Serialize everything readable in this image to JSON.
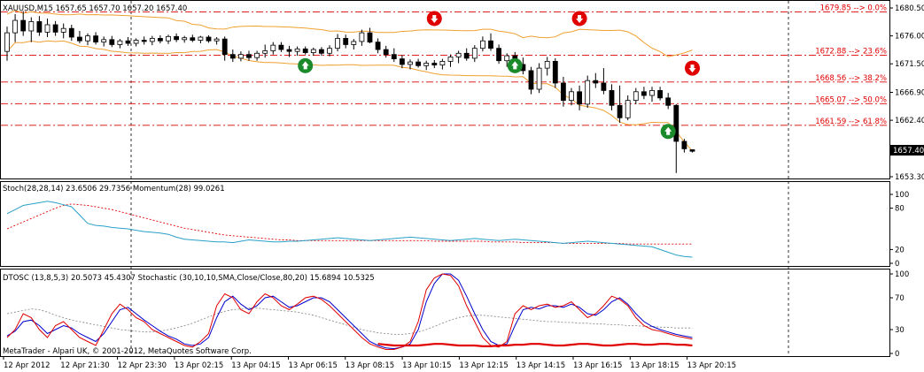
{
  "main_panel": {
    "symbol_header": "XAUUSD,M15  1657.65 1657.70 1657.20 1657.40",
    "price_ticks": [
      "1680.50",
      "1676.00",
      "1671.50",
      "1666.90",
      "1662.40",
      "1653.30"
    ],
    "current_price": "1657.40",
    "fib_levels": [
      {
        "label": "1679.85 --> 0.0%",
        "price": 1679.85
      },
      {
        "label": "1672.88 --> 23.6%",
        "price": 1672.88
      },
      {
        "label": "1668.56 --> 38.2%",
        "price": 1668.56
      },
      {
        "label": "1665.07 --> 50.0%",
        "price": 1665.07
      },
      {
        "label": "1661.59 --> 61.8%",
        "price": 1661.59
      }
    ],
    "colors": {
      "fib": "#e00000",
      "bands": "#f0a030",
      "bull_body": "#ffffff",
      "bear_body": "#000000",
      "sell_signal": "#e00000",
      "buy_signal": "#1a8a2a"
    }
  },
  "stoch_panel": {
    "header": "Stoch(28,28,14) 23.6506 29.7356  Momentum(28) 99.0261",
    "ticks": [
      "100",
      "80",
      "20",
      "0"
    ],
    "colors": {
      "main": "#2aa0c8",
      "signal": "#e00000"
    }
  },
  "dtosc_panel": {
    "header": "DTOSC (13,8,5,3) 20.5073 45.4307  Stochastic (30,10,10,SMA,Close/Close,80,20) 15.6894 10.5325",
    "ticks": [
      "100",
      "70",
      "30",
      "0"
    ],
    "colors": {
      "fast": "#e00000",
      "slow": "#0000cc",
      "gray": "#808080"
    }
  },
  "footer_text": "MetaTrader - Alpari UK, © 2001-2012, MetaQuotes Software Corp.",
  "time_labels": [
    "12 Apr 2012",
    "12 Apr 21:30",
    "12 Apr 23:30",
    "13 Apr 02:15",
    "13 Apr 04:15",
    "13 Apr 06:15",
    "13 Apr 08:15",
    "13 Apr 10:15",
    "13 Apr 12:15",
    "13 Apr 14:15",
    "13 Apr 16:15",
    "13 Apr 18:15",
    "13 Apr 20:15"
  ],
  "chart_data": {
    "type": "candlestick",
    "symbol": "XAUUSD",
    "timeframe": "M15",
    "ylim": [
      1653.3,
      1681.5
    ],
    "candles": [
      {
        "o": 1673.5,
        "h": 1677.5,
        "l": 1672.0,
        "c": 1676.5
      },
      {
        "o": 1676.5,
        "h": 1679.5,
        "l": 1675.0,
        "c": 1678.5
      },
      {
        "o": 1678.5,
        "h": 1680.0,
        "l": 1676.0,
        "c": 1676.8
      },
      {
        "o": 1676.8,
        "h": 1679.0,
        "l": 1675.0,
        "c": 1678.3
      },
      {
        "o": 1678.3,
        "h": 1679.2,
        "l": 1676.0,
        "c": 1676.6
      },
      {
        "o": 1676.6,
        "h": 1678.8,
        "l": 1675.8,
        "c": 1677.8
      },
      {
        "o": 1677.8,
        "h": 1678.4,
        "l": 1676.0,
        "c": 1676.6
      },
      {
        "o": 1676.6,
        "h": 1678.0,
        "l": 1675.6,
        "c": 1677.2
      },
      {
        "o": 1677.2,
        "h": 1677.8,
        "l": 1675.2,
        "c": 1675.8
      },
      {
        "o": 1675.8,
        "h": 1676.8,
        "l": 1674.8,
        "c": 1675.2
      },
      {
        "o": 1675.2,
        "h": 1676.4,
        "l": 1674.5,
        "c": 1676.0
      },
      {
        "o": 1676.0,
        "h": 1676.6,
        "l": 1674.6,
        "c": 1675.0
      },
      {
        "o": 1675.0,
        "h": 1675.9,
        "l": 1674.3,
        "c": 1675.4
      },
      {
        "o": 1675.4,
        "h": 1676.0,
        "l": 1674.2,
        "c": 1674.6
      },
      {
        "o": 1674.6,
        "h": 1675.5,
        "l": 1674.0,
        "c": 1675.2
      },
      {
        "o": 1675.2,
        "h": 1675.8,
        "l": 1674.4,
        "c": 1674.8
      },
      {
        "o": 1674.8,
        "h": 1675.6,
        "l": 1674.3,
        "c": 1675.3
      },
      {
        "o": 1675.3,
        "h": 1675.9,
        "l": 1674.6,
        "c": 1675.1
      },
      {
        "o": 1675.1,
        "h": 1676.0,
        "l": 1674.5,
        "c": 1675.6
      },
      {
        "o": 1675.6,
        "h": 1676.1,
        "l": 1674.8,
        "c": 1675.2
      },
      {
        "o": 1675.2,
        "h": 1676.2,
        "l": 1674.7,
        "c": 1675.9
      },
      {
        "o": 1675.9,
        "h": 1676.4,
        "l": 1675.0,
        "c": 1675.4
      },
      {
        "o": 1675.4,
        "h": 1676.0,
        "l": 1674.9,
        "c": 1675.7
      },
      {
        "o": 1675.7,
        "h": 1676.2,
        "l": 1675.0,
        "c": 1675.3
      },
      {
        "o": 1675.3,
        "h": 1676.0,
        "l": 1674.8,
        "c": 1675.8
      },
      {
        "o": 1675.8,
        "h": 1676.1,
        "l": 1674.9,
        "c": 1675.2
      },
      {
        "o": 1675.2,
        "h": 1675.8,
        "l": 1674.6,
        "c": 1675.5
      },
      {
        "o": 1675.5,
        "h": 1675.9,
        "l": 1672.0,
        "c": 1673.0
      },
      {
        "o": 1673.0,
        "h": 1673.8,
        "l": 1671.8,
        "c": 1672.4
      },
      {
        "o": 1672.4,
        "h": 1673.5,
        "l": 1671.9,
        "c": 1673.0
      },
      {
        "o": 1673.0,
        "h": 1673.6,
        "l": 1672.0,
        "c": 1672.5
      },
      {
        "o": 1672.5,
        "h": 1673.6,
        "l": 1672.0,
        "c": 1673.2
      },
      {
        "o": 1673.2,
        "h": 1674.6,
        "l": 1672.5,
        "c": 1673.6
      },
      {
        "o": 1673.6,
        "h": 1675.0,
        "l": 1673.0,
        "c": 1674.5
      },
      {
        "o": 1674.5,
        "h": 1675.0,
        "l": 1673.4,
        "c": 1673.8
      },
      {
        "o": 1673.8,
        "h": 1674.4,
        "l": 1672.6,
        "c": 1673.5
      },
      {
        "o": 1673.5,
        "h": 1674.3,
        "l": 1672.8,
        "c": 1673.9
      },
      {
        "o": 1673.9,
        "h": 1674.3,
        "l": 1673.0,
        "c": 1673.3
      },
      {
        "o": 1673.3,
        "h": 1674.1,
        "l": 1672.8,
        "c": 1673.8
      },
      {
        "o": 1673.8,
        "h": 1674.2,
        "l": 1672.8,
        "c": 1673.2
      },
      {
        "o": 1673.2,
        "h": 1674.5,
        "l": 1672.7,
        "c": 1674.0
      },
      {
        "o": 1674.0,
        "h": 1676.3,
        "l": 1673.5,
        "c": 1675.6
      },
      {
        "o": 1675.6,
        "h": 1676.2,
        "l": 1674.0,
        "c": 1674.6
      },
      {
        "o": 1674.6,
        "h": 1675.5,
        "l": 1673.8,
        "c": 1675.1
      },
      {
        "o": 1675.1,
        "h": 1677.0,
        "l": 1674.4,
        "c": 1676.5
      },
      {
        "o": 1676.5,
        "h": 1677.3,
        "l": 1674.8,
        "c": 1675.0
      },
      {
        "o": 1675.0,
        "h": 1675.6,
        "l": 1673.2,
        "c": 1673.8
      },
      {
        "o": 1673.8,
        "h": 1674.4,
        "l": 1672.5,
        "c": 1673.0
      },
      {
        "o": 1673.0,
        "h": 1674.0,
        "l": 1671.8,
        "c": 1672.3
      },
      {
        "o": 1672.3,
        "h": 1672.9,
        "l": 1670.8,
        "c": 1671.4
      },
      {
        "o": 1671.4,
        "h": 1672.2,
        "l": 1670.6,
        "c": 1671.8
      },
      {
        "o": 1671.8,
        "h": 1672.3,
        "l": 1670.9,
        "c": 1671.2
      },
      {
        "o": 1671.2,
        "h": 1672.0,
        "l": 1670.5,
        "c": 1671.6
      },
      {
        "o": 1671.6,
        "h": 1672.1,
        "l": 1670.8,
        "c": 1671.3
      },
      {
        "o": 1671.3,
        "h": 1672.3,
        "l": 1670.6,
        "c": 1671.9
      },
      {
        "o": 1671.9,
        "h": 1673.0,
        "l": 1671.0,
        "c": 1672.6
      },
      {
        "o": 1672.6,
        "h": 1673.6,
        "l": 1671.6,
        "c": 1673.2
      },
      {
        "o": 1673.2,
        "h": 1674.0,
        "l": 1672.0,
        "c": 1672.4
      },
      {
        "o": 1672.4,
        "h": 1674.5,
        "l": 1671.8,
        "c": 1674.0
      },
      {
        "o": 1674.0,
        "h": 1675.9,
        "l": 1673.5,
        "c": 1675.2
      },
      {
        "o": 1675.2,
        "h": 1676.4,
        "l": 1673.6,
        "c": 1674.0
      },
      {
        "o": 1674.0,
        "h": 1674.6,
        "l": 1671.5,
        "c": 1672.0
      },
      {
        "o": 1672.0,
        "h": 1673.2,
        "l": 1671.0,
        "c": 1672.8
      },
      {
        "o": 1672.8,
        "h": 1673.4,
        "l": 1671.0,
        "c": 1671.4
      },
      {
        "o": 1671.4,
        "h": 1672.5,
        "l": 1669.8,
        "c": 1670.4
      },
      {
        "o": 1670.4,
        "h": 1671.0,
        "l": 1666.6,
        "c": 1667.4
      },
      {
        "o": 1667.4,
        "h": 1671.6,
        "l": 1666.8,
        "c": 1670.8
      },
      {
        "o": 1670.8,
        "h": 1672.6,
        "l": 1669.6,
        "c": 1671.9
      },
      {
        "o": 1671.9,
        "h": 1672.4,
        "l": 1667.6,
        "c": 1668.4
      },
      {
        "o": 1668.4,
        "h": 1669.4,
        "l": 1664.6,
        "c": 1665.6
      },
      {
        "o": 1665.6,
        "h": 1667.6,
        "l": 1664.8,
        "c": 1667.0
      },
      {
        "o": 1667.0,
        "h": 1668.0,
        "l": 1664.0,
        "c": 1665.0
      },
      {
        "o": 1665.0,
        "h": 1669.6,
        "l": 1664.4,
        "c": 1668.8
      },
      {
        "o": 1668.8,
        "h": 1670.0,
        "l": 1667.6,
        "c": 1668.4
      },
      {
        "o": 1668.4,
        "h": 1670.8,
        "l": 1666.6,
        "c": 1667.2
      },
      {
        "o": 1667.2,
        "h": 1668.2,
        "l": 1664.0,
        "c": 1664.8
      },
      {
        "o": 1664.8,
        "h": 1668.0,
        "l": 1662.0,
        "c": 1662.8
      },
      {
        "o": 1662.8,
        "h": 1666.4,
        "l": 1662.4,
        "c": 1665.6
      },
      {
        "o": 1665.6,
        "h": 1667.6,
        "l": 1665.0,
        "c": 1667.0
      },
      {
        "o": 1667.0,
        "h": 1667.8,
        "l": 1665.8,
        "c": 1666.4
      },
      {
        "o": 1666.4,
        "h": 1667.8,
        "l": 1665.4,
        "c": 1667.2
      },
      {
        "o": 1667.2,
        "h": 1667.8,
        "l": 1665.6,
        "c": 1666.0
      },
      {
        "o": 1666.0,
        "h": 1666.8,
        "l": 1664.2,
        "c": 1664.8
      },
      {
        "o": 1664.8,
        "h": 1665.0,
        "l": 1653.9,
        "c": 1659.0
      },
      {
        "o": 1659.0,
        "h": 1659.4,
        "l": 1657.2,
        "c": 1657.8
      },
      {
        "o": 1657.65,
        "h": 1657.7,
        "l": 1657.2,
        "c": 1657.4
      }
    ],
    "signals": [
      {
        "type": "sell",
        "candle": 53,
        "price": 1678.8
      },
      {
        "type": "sell",
        "candle": 71,
        "price": 1678.8
      },
      {
        "type": "sell",
        "candle": 85,
        "price": 1670.8
      },
      {
        "type": "buy",
        "candle": 37,
        "price": 1671.2
      },
      {
        "type": "buy",
        "candle": 63,
        "price": 1671.2
      },
      {
        "type": "buy",
        "candle": 82,
        "price": 1660.6
      }
    ],
    "stoch_main": [
      72,
      78,
      84,
      86,
      88,
      90,
      88,
      85,
      82,
      70,
      58,
      55,
      54,
      52,
      51,
      50,
      48,
      46,
      45,
      44,
      42,
      38,
      35,
      34,
      33,
      32,
      31,
      31,
      30,
      32,
      34,
      33,
      32,
      31,
      31,
      32,
      32,
      33,
      34,
      35,
      36,
      37,
      36,
      35,
      34,
      33,
      34,
      35,
      36,
      37,
      38,
      37,
      36,
      35,
      34,
      33,
      34,
      35,
      36,
      35,
      34,
      33,
      34,
      35,
      34,
      33,
      32,
      31,
      30,
      29,
      30,
      31,
      32,
      31,
      30,
      29,
      28,
      27,
      26,
      25,
      24,
      20,
      16,
      12,
      10,
      9
    ],
    "stoch_signal": [
      50,
      55,
      60,
      65,
      70,
      75,
      80,
      84,
      86,
      85,
      84,
      82,
      80,
      78,
      75,
      72,
      69,
      66,
      63,
      60,
      57,
      54,
      51,
      49,
      47,
      45,
      43,
      41,
      40,
      39,
      38,
      37,
      36,
      35,
      34,
      34,
      33,
      33,
      33,
      33,
      33,
      33,
      33,
      33,
      33,
      33,
      33,
      33,
      33,
      33,
      33,
      33,
      33,
      32,
      32,
      32,
      32,
      32,
      32,
      32,
      31,
      31,
      31,
      31,
      30,
      30,
      30,
      30,
      30,
      29,
      29,
      29,
      29,
      29,
      29,
      29,
      29,
      28,
      28,
      28,
      28,
      28,
      28,
      28,
      28,
      28
    ],
    "dtosc_fast": [
      20,
      30,
      50,
      45,
      30,
      20,
      35,
      40,
      30,
      20,
      15,
      10,
      30,
      50,
      62,
      55,
      45,
      40,
      30,
      25,
      20,
      15,
      10,
      8,
      15,
      25,
      60,
      75,
      70,
      55,
      50,
      65,
      75,
      70,
      60,
      55,
      62,
      70,
      72,
      68,
      60,
      50,
      40,
      30,
      20,
      12,
      8,
      5,
      5,
      8,
      15,
      40,
      80,
      95,
      100,
      98,
      85,
      60,
      40,
      20,
      10,
      8,
      15,
      50,
      60,
      55,
      60,
      62,
      58,
      60,
      65,
      55,
      45,
      50,
      60,
      72,
      68,
      60,
      45,
      35,
      30,
      28,
      25,
      22,
      20,
      18
    ],
    "dtosc_slow": [
      22,
      28,
      40,
      42,
      35,
      25,
      30,
      35,
      32,
      25,
      20,
      15,
      25,
      40,
      55,
      58,
      50,
      42,
      35,
      28,
      22,
      18,
      12,
      10,
      12,
      20,
      45,
      65,
      72,
      62,
      55,
      60,
      70,
      72,
      65,
      58,
      60,
      65,
      70,
      70,
      65,
      55,
      45,
      35,
      25,
      15,
      10,
      7,
      6,
      8,
      12,
      30,
      65,
      88,
      100,
      100,
      92,
      72,
      50,
      30,
      15,
      10,
      12,
      35,
      55,
      58,
      56,
      60,
      60,
      58,
      62,
      58,
      50,
      48,
      55,
      65,
      70,
      62,
      50,
      40,
      34,
      30,
      27,
      24,
      22,
      20
    ],
    "dtosc_gray": [
      50,
      52,
      54,
      56,
      55,
      52,
      48,
      45,
      42,
      40,
      38,
      36,
      34,
      32,
      30,
      29,
      28,
      27,
      27,
      28,
      30,
      32,
      35,
      38,
      42,
      46,
      50,
      53,
      55,
      56,
      57,
      57,
      56,
      55,
      54,
      53,
      52,
      50,
      48,
      45,
      42,
      39,
      36,
      33,
      30,
      28,
      26,
      25,
      24,
      24,
      25,
      27,
      30,
      34,
      38,
      42,
      45,
      47,
      48,
      48,
      47,
      46,
      45,
      44,
      43,
      42,
      41,
      40,
      40,
      39,
      39,
      38,
      38,
      37,
      37,
      36,
      36,
      35,
      35,
      34,
      34,
      33,
      33,
      32,
      32,
      32
    ],
    "dtosc_red": [
      12,
      11,
      10,
      10,
      10,
      10,
      11,
      12,
      12,
      11,
      10,
      10,
      10,
      9,
      9,
      10,
      10,
      11,
      11,
      12,
      12,
      11,
      10,
      10,
      11,
      12,
      12,
      11,
      10,
      10,
      11,
      12,
      12,
      11,
      11,
      12,
      12,
      11,
      11,
      10
    ]
  }
}
